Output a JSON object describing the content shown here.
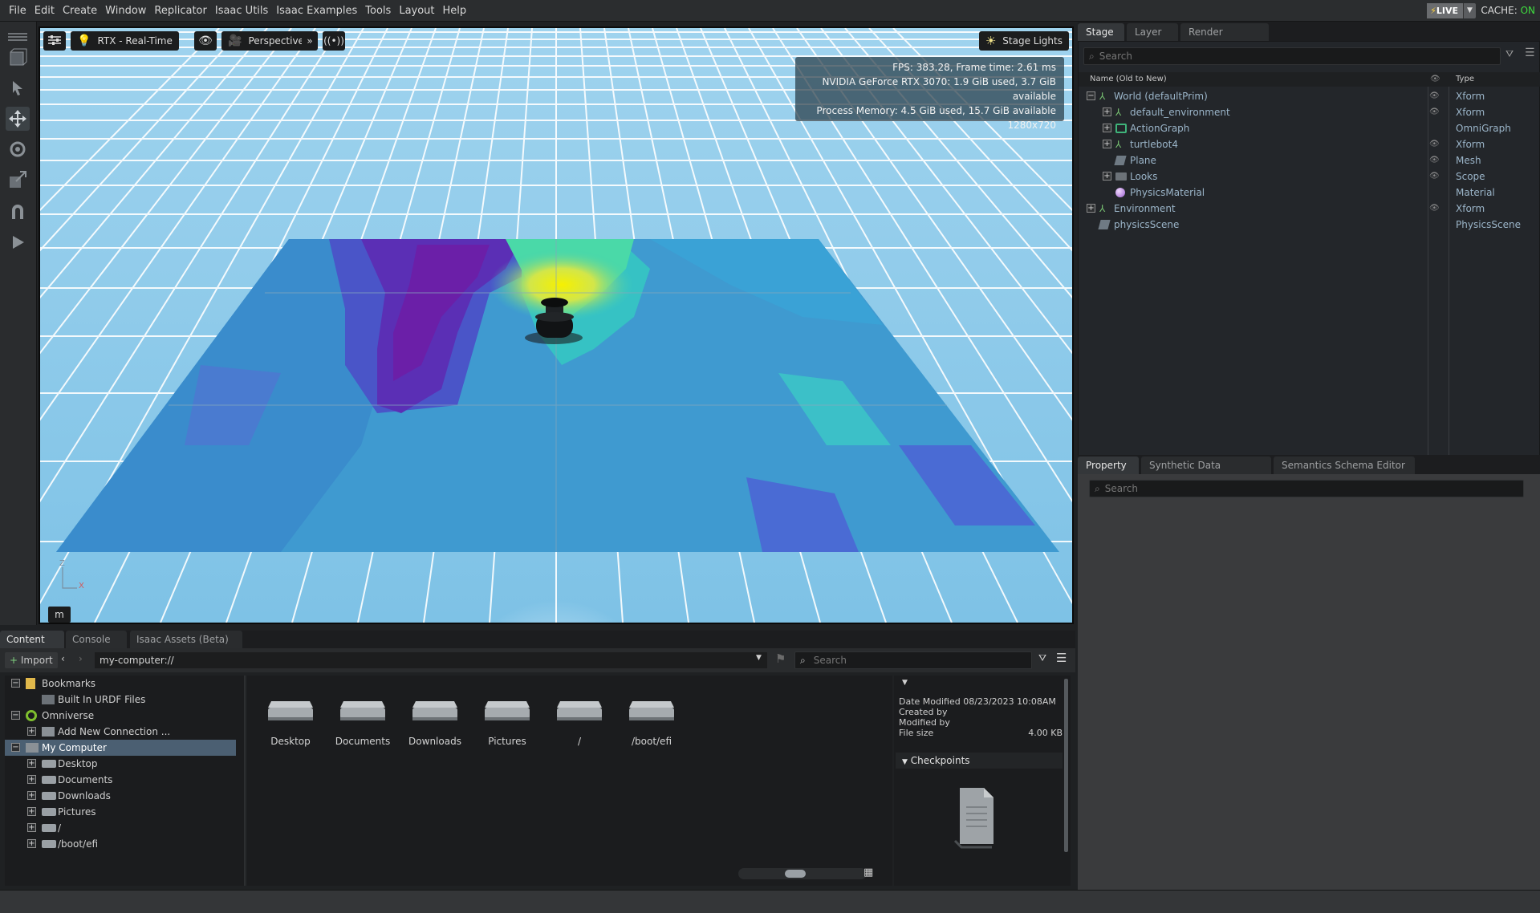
{
  "menu": [
    "File",
    "Edit",
    "Create",
    "Window",
    "Replicator",
    "Isaac Utils",
    "Isaac Examples",
    "Tools",
    "Layout",
    "Help"
  ],
  "live": {
    "label": "LIVE",
    "cache_label": "CACHE:",
    "cache_state": "ON",
    "cache_color": "#3fdc3f"
  },
  "left_tools": [
    "select-object-icon",
    "select-icon",
    "move-icon",
    "rotate-icon",
    "scale-icon",
    "snap-icon",
    "play-icon"
  ],
  "viewport": {
    "renderer": "RTX - Real-Time",
    "camera": "Perspective",
    "lights": "Stage Lights",
    "stats": [
      "FPS: 383.28, Frame time: 2.61 ms",
      "NVIDIA GeForce RTX 3070: 1.9 GiB used, 3.7 GiB available",
      "Process Memory: 4.5 GiB used, 15.7 GiB available",
      "1280x720"
    ],
    "units": "m",
    "axis_labels": {
      "z": "Z",
      "x": "X"
    }
  },
  "stage": {
    "tabs": [
      "Stage",
      "Layer",
      "Render Settings"
    ],
    "search_placeholder": "Search",
    "col_name": "Name (Old to New)",
    "col_type": "Type",
    "rows": [
      {
        "name": "World (defaultPrim)",
        "type": "Xform",
        "icon": "xform-icon",
        "expander": "−",
        "visible": true
      },
      {
        "name": "default_environment",
        "type": "Xform",
        "icon": "xform-icon",
        "expander": "+",
        "visible": true
      },
      {
        "name": "ActionGraph",
        "type": "OmniGraph",
        "icon": "graph-icon",
        "expander": "+",
        "visible": false
      },
      {
        "name": "turtlebot4",
        "type": "Xform",
        "icon": "xform-icon",
        "expander": "+",
        "visible": true
      },
      {
        "name": "Plane",
        "type": "Mesh",
        "icon": "mesh-icon",
        "expander": "",
        "visible": true
      },
      {
        "name": "Looks",
        "type": "Scope",
        "icon": "folder-icon",
        "expander": "+",
        "visible": true
      },
      {
        "name": "PhysicsMaterial",
        "type": "Material",
        "icon": "material-icon",
        "expander": "",
        "visible": false
      },
      {
        "name": "Environment",
        "type": "Xform",
        "icon": "xform-icon",
        "expander": "+",
        "visible": true
      },
      {
        "name": "physicsScene",
        "type": "PhysicsScene",
        "icon": "physics-scene-icon",
        "expander": "",
        "visible": false
      }
    ]
  },
  "property": {
    "tabs": [
      "Property",
      "Synthetic Data Recorder",
      "Semantics Schema Editor"
    ],
    "search_placeholder": "Search"
  },
  "content": {
    "tabs": [
      "Content",
      "Console",
      "Isaac Assets (Beta)"
    ],
    "import_label": "Import",
    "path": "my-computer://",
    "search_placeholder": "Search",
    "sidebar": [
      {
        "label": "Bookmarks",
        "expander": "−",
        "icon": "bookmark-icon",
        "selected": false
      },
      {
        "label": "Built In URDF Files",
        "expander": "",
        "icon": "folder-icon",
        "selected": false
      },
      {
        "label": "Omniverse",
        "expander": "−",
        "icon": "omniverse-icon",
        "selected": false
      },
      {
        "label": "Add New Connection ...",
        "expander": "+",
        "icon": "connection-icon",
        "selected": false
      },
      {
        "label": "My Computer",
        "expander": "−",
        "icon": "computer-icon",
        "selected": true
      },
      {
        "label": "Desktop",
        "expander": "+",
        "icon": "drive-icon",
        "selected": false
      },
      {
        "label": "Documents",
        "expander": "+",
        "icon": "drive-icon",
        "selected": false
      },
      {
        "label": "Downloads",
        "expander": "+",
        "icon": "drive-icon",
        "selected": false
      },
      {
        "label": "Pictures",
        "expander": "+",
        "icon": "drive-icon",
        "selected": false
      },
      {
        "label": "/",
        "expander": "+",
        "icon": "drive-icon",
        "selected": false
      },
      {
        "label": "/boot/efi",
        "expander": "+",
        "icon": "drive-icon",
        "selected": false
      }
    ],
    "folders": [
      "Desktop",
      "Documents",
      "Downloads",
      "Pictures",
      "/",
      "/boot/efi"
    ],
    "details": {
      "date_modified_label": "Date Modified",
      "date_modified": "08/23/2023 10:08AM",
      "created_by_label": "Created by",
      "modified_by_label": "Modified by",
      "file_size_label": "File size",
      "file_size": "4.00 KB",
      "checkpoints_label": "Checkpoints"
    }
  }
}
